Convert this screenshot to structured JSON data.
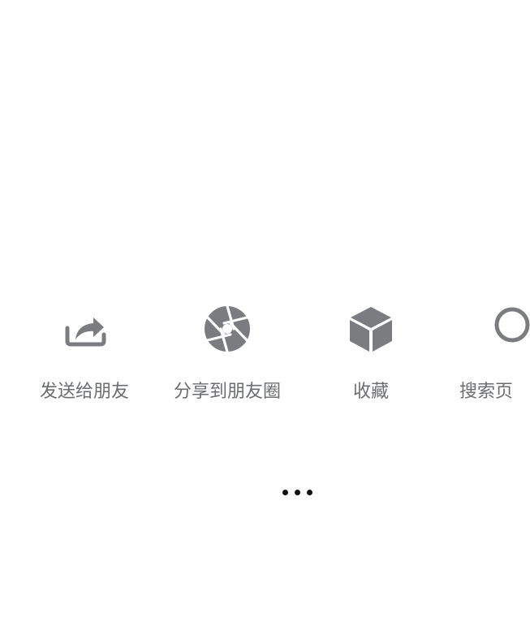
{
  "share_sheet": {
    "items": [
      {
        "label": "发送给朋友",
        "icon": "share-forward-icon"
      },
      {
        "label": "分享到朋友圈",
        "icon": "moments-aperture-icon"
      },
      {
        "label": "收藏",
        "icon": "favorite-cube-icon"
      },
      {
        "label": "搜索页",
        "icon": "search-icon"
      }
    ]
  },
  "colors": {
    "icon": "#7a7c7f",
    "label": "#6b6d70",
    "dots": "#111111",
    "background": "#ffffff"
  }
}
